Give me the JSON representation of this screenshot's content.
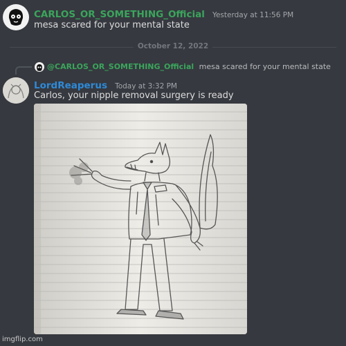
{
  "message1": {
    "author": "CARLOS_OR_SOMETHING_Official",
    "timestamp": "Yesterday at 11:56 PM",
    "content": "mesa scared for your mental state"
  },
  "date_divider": "October 12, 2022",
  "message2": {
    "reply": {
      "author": "@CARLOS_OR_SOMETHING_Official",
      "content": "mesa scared for your mental state"
    },
    "author": "LordReaperus",
    "timestamp": "Today at 3:32 PM",
    "content": "Carlos, your nipple removal surgery is ready",
    "attachment_icon": "drawing-image"
  },
  "colors": {
    "background": "#36393f",
    "green_name": "#3ba55c",
    "blue_name": "#2e8ad8"
  },
  "watermark": "imgflip.com"
}
